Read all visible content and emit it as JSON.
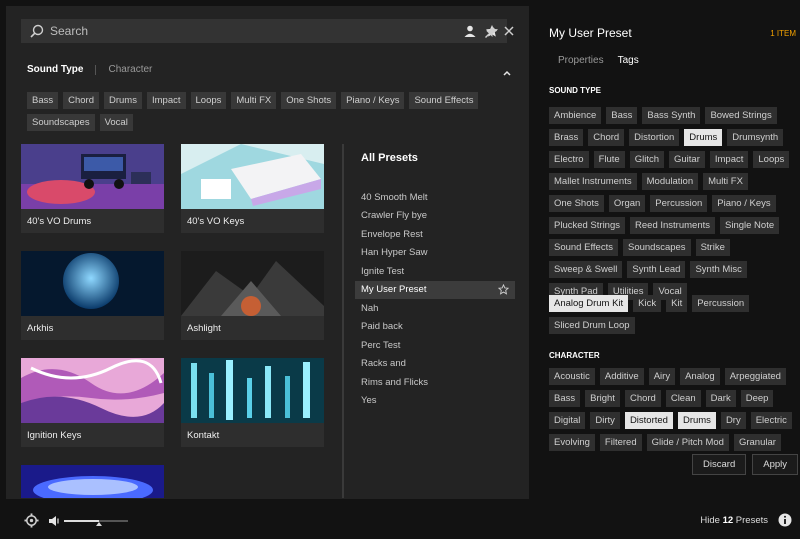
{
  "search": {
    "placeholder": "Search"
  },
  "filter_tabs": {
    "sound_type": "Sound Type",
    "character": "Character"
  },
  "left_chips": [
    "Bass",
    "Chord",
    "Drums",
    "Impact",
    "Loops",
    "Multi FX",
    "One Shots",
    "Piano / Keys",
    "Sound Effects",
    "Soundscapes",
    "Vocal"
  ],
  "cards": [
    {
      "label": "40's VO Drums"
    },
    {
      "label": "40's VO Keys"
    },
    {
      "label": "Arkhis"
    },
    {
      "label": "Ashlight"
    },
    {
      "label": "Ignition Keys"
    },
    {
      "label": "Kontakt"
    },
    {
      "label": ""
    }
  ],
  "presets": {
    "header": "All Presets",
    "items": [
      "40 Smooth Melt",
      "Crawler Fly bye",
      "Envelope Rest",
      "Han Hyper Saw",
      "Ignite Test",
      "My User Preset",
      "Nah",
      "Paid back",
      "Perc Test",
      "Racks and",
      "Rims and Flicks",
      "Yes"
    ],
    "selected_index": 5
  },
  "right": {
    "title": "My User Preset",
    "count": "1 ITEM",
    "tab_properties": "Properties",
    "tab_tags": "Tags",
    "sound_type_label": "SOUND TYPE",
    "character_label": "CHARACTER",
    "sound_types": [
      "Ambience",
      "Bass",
      "Bass Synth",
      "Bowed Strings",
      "Brass",
      "Chord",
      "Distortion",
      "Drums",
      "Drumsynth",
      "Electro",
      "Flute",
      "Glitch",
      "Guitar",
      "Impact",
      "Loops",
      "Mallet Instruments",
      "Modulation",
      "Multi FX",
      "One Shots",
      "Organ",
      "Percussion",
      "Piano / Keys",
      "Plucked Strings",
      "Reed Instruments",
      "Single Note",
      "Sound Effects",
      "Soundscapes",
      "Strike",
      "Sweep & Swell",
      "Synth Lead",
      "Synth Misc",
      "Synth Pad",
      "Utilities",
      "Vocal"
    ],
    "sound_types_selected": [
      "Drums"
    ],
    "sub_types": [
      "Analog Drum Kit",
      "Kick",
      "Kit",
      "Percussion",
      "Sliced Drum Loop"
    ],
    "sub_types_selected": [
      "Analog Drum Kit"
    ],
    "characters": [
      "Acoustic",
      "Additive",
      "Airy",
      "Analog",
      "Arpeggiated",
      "Bass",
      "Bright",
      "Chord",
      "Clean",
      "Dark",
      "Deep",
      "Digital",
      "Dirty",
      "Distorted",
      "Drums",
      "Dry",
      "Electric",
      "Evolving",
      "Filtered",
      "Glide / Pitch Mod",
      "Granular"
    ],
    "characters_selected": [
      "Distorted",
      "Drums"
    ],
    "discard": "Discard",
    "apply": "Apply"
  },
  "footer": {
    "hide_prefix": "Hide",
    "hide_count": "12",
    "hide_suffix": "Presets",
    "volume_level": 0.55
  }
}
